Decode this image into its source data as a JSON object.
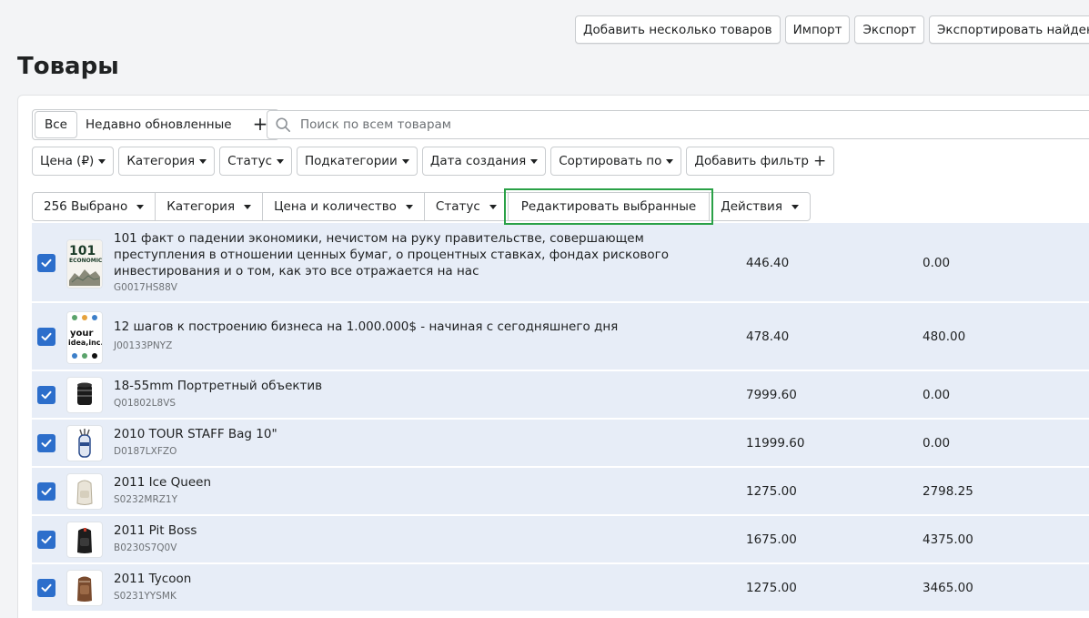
{
  "header": {
    "actions": [
      "Добавить несколько товаров",
      "Импорт",
      "Экспорт",
      "Экспортировать найденные"
    ],
    "title": "Товары"
  },
  "tabs": {
    "all": "Все",
    "recent": "Недавно обновленные",
    "add": "+"
  },
  "search": {
    "placeholder": "Поиск по всем товарам"
  },
  "filters": [
    "Цена (₽)",
    "Категория",
    "Статус",
    "Подкатегории",
    "Дата создания",
    "Сортировать по"
  ],
  "add_filter": "Добавить фильтр",
  "bulk": {
    "selected": "256 Выбрано",
    "category": "Категория",
    "price_qty": "Цена и количество",
    "status": "Статус",
    "edit_selected": "Редактировать выбранные",
    "actions": "Действия"
  },
  "products": [
    {
      "title": "101 факт о падении экономики, нечистом на руку правительстве, совершающем преступления в отношении ценных бумаг, о процентных ставках, фондах рискового инвестирования и о том, как это все отражается на нас",
      "sku": "G0017HS88V",
      "price": "446.40",
      "compare": "0.00",
      "thumb": "book-101-economics",
      "checked": true
    },
    {
      "title": "12 шагов к построению бизнеса на 1.000.000$ - начиная с сегодняшнего дня",
      "sku": "J00133PNYZ",
      "price": "478.40",
      "compare": "480.00",
      "thumb": "book-your-idea-inc",
      "checked": true
    },
    {
      "title": "18-55mm Портретный объектив",
      "sku": "Q01802L8VS",
      "price": "7999.60",
      "compare": "0.00",
      "thumb": "camera-lens",
      "checked": true
    },
    {
      "title": "2010 TOUR STAFF Bag 10\"",
      "sku": "D0187LXFZO",
      "price": "11999.60",
      "compare": "0.00",
      "thumb": "golf-bag",
      "checked": true
    },
    {
      "title": "2011 Ice Queen",
      "sku": "S0232MRZ1Y",
      "price": "1275.00",
      "compare": "2798.25",
      "thumb": "backpack-white",
      "checked": true
    },
    {
      "title": "2011 Pit Boss",
      "sku": "B0230S7Q0V",
      "price": "1675.00",
      "compare": "4375.00",
      "thumb": "backpack-black",
      "checked": true
    },
    {
      "title": "2011 Tycoon",
      "sku": "S0231YYSMK",
      "price": "1275.00",
      "compare": "3465.00",
      "thumb": "backpack-brown",
      "checked": true
    }
  ],
  "colors": {
    "accent": "#2c6ecb",
    "selected_row": "#e7edf7",
    "highlight_outline": "#2aa147"
  }
}
